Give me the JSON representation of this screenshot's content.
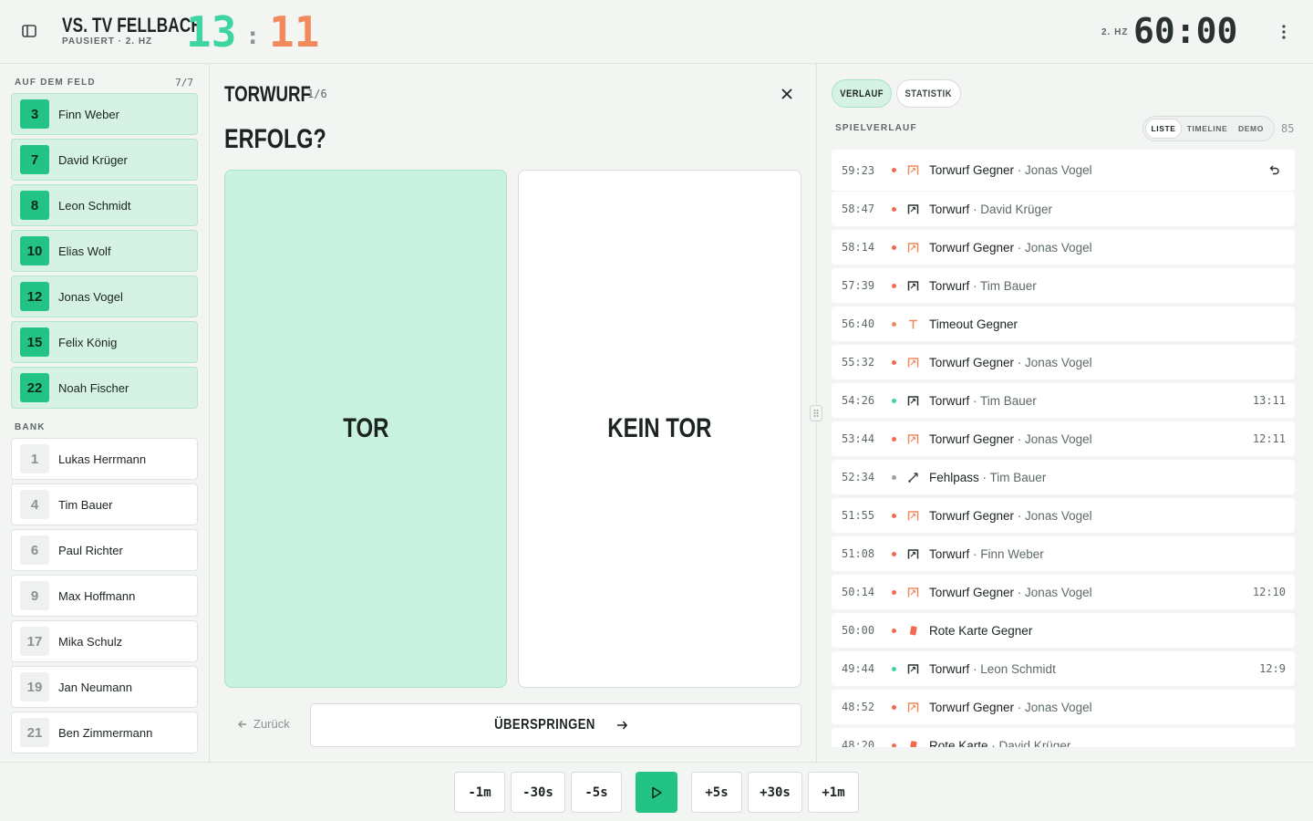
{
  "header": {
    "team_name": "VS. TV FELLBACH",
    "status": "PAUSIERT · 2. HZ",
    "score_home": "13",
    "score_sep": ":",
    "score_away": "11",
    "half_label": "2. HZ",
    "clock": "60:00"
  },
  "left_panel": {
    "field_title": "AUF DEM FELD",
    "field_count": "7/7",
    "field_players": [
      {
        "number": "3",
        "name": "Finn Weber"
      },
      {
        "number": "7",
        "name": "David Krüger"
      },
      {
        "number": "8",
        "name": "Leon Schmidt"
      },
      {
        "number": "10",
        "name": "Elias Wolf"
      },
      {
        "number": "12",
        "name": "Jonas Vogel"
      },
      {
        "number": "15",
        "name": "Felix König"
      },
      {
        "number": "22",
        "name": "Noah Fischer"
      }
    ],
    "bench_title": "BANK",
    "bench_players": [
      {
        "number": "1",
        "name": "Lukas Herrmann"
      },
      {
        "number": "4",
        "name": "Tim Bauer"
      },
      {
        "number": "6",
        "name": "Paul Richter"
      },
      {
        "number": "9",
        "name": "Max Hoffmann"
      },
      {
        "number": "17",
        "name": "Mika Schulz"
      },
      {
        "number": "19",
        "name": "Jan Neumann"
      },
      {
        "number": "21",
        "name": "Ben Zimmermann"
      }
    ]
  },
  "action": {
    "title": "TORWURF",
    "step": "1/6",
    "question": "ERFOLG?",
    "option_yes": "TOR",
    "option_no": "KEIN TOR",
    "back_label": "Zurück",
    "skip_label": "ÜBERSPRINGEN"
  },
  "right_panel": {
    "tabs": [
      "VERLAUF",
      "STATISTIK"
    ],
    "log_title": "SPIELVERLAUF",
    "view_modes": [
      "LISTE",
      "TIMELINE",
      "DEMO"
    ],
    "event_count": "85",
    "events": [
      {
        "time": "59:23",
        "type": "Torwurf Gegner",
        "sep": " · ",
        "player": "Jonas Vogel",
        "score": "",
        "dot": "#f26b4f",
        "icon": "goal-opponent-icon"
      },
      {
        "time": "58:47",
        "type": "Torwurf",
        "sep": " · ",
        "player": "David Krüger",
        "score": "",
        "dot": "#f26b4f",
        "icon": "goal-icon"
      },
      {
        "time": "58:14",
        "type": "Torwurf Gegner",
        "sep": " · ",
        "player": "Jonas Vogel",
        "score": "",
        "dot": "#f26b4f",
        "icon": "goal-opponent-icon"
      },
      {
        "time": "57:39",
        "type": "Torwurf",
        "sep": " · ",
        "player": "Tim Bauer",
        "score": "",
        "dot": "#f26b4f",
        "icon": "goal-icon"
      },
      {
        "time": "56:40",
        "type": "Timeout Gegner",
        "sep": "",
        "player": "",
        "score": "",
        "dot": "#f08a5d",
        "icon": "timeout-icon"
      },
      {
        "time": "55:32",
        "type": "Torwurf Gegner",
        "sep": " · ",
        "player": "Jonas Vogel",
        "score": "",
        "dot": "#f26b4f",
        "icon": "goal-opponent-icon"
      },
      {
        "time": "54:26",
        "type": "Torwurf",
        "sep": " · ",
        "player": "Tim Bauer",
        "score": "13:11",
        "dot": "#3fd5a0",
        "icon": "goal-icon"
      },
      {
        "time": "53:44",
        "type": "Torwurf Gegner",
        "sep": " · ",
        "player": "Jonas Vogel",
        "score": "12:11",
        "dot": "#f26b4f",
        "icon": "goal-opponent-icon"
      },
      {
        "time": "52:34",
        "type": "Fehlpass",
        "sep": " · ",
        "player": "Tim Bauer",
        "score": "",
        "dot": "#9aa39f",
        "icon": "pass-icon"
      },
      {
        "time": "51:55",
        "type": "Torwurf Gegner",
        "sep": " · ",
        "player": "Jonas Vogel",
        "score": "",
        "dot": "#f26b4f",
        "icon": "goal-opponent-icon"
      },
      {
        "time": "51:08",
        "type": "Torwurf",
        "sep": " · ",
        "player": "Finn Weber",
        "score": "",
        "dot": "#f26b4f",
        "icon": "goal-icon"
      },
      {
        "time": "50:14",
        "type": "Torwurf Gegner",
        "sep": " · ",
        "player": "Jonas Vogel",
        "score": "12:10",
        "dot": "#f26b4f",
        "icon": "goal-opponent-icon"
      },
      {
        "time": "50:00",
        "type": "Rote Karte Gegner",
        "sep": "",
        "player": "",
        "score": "",
        "dot": "#f26b4f",
        "icon": "red-card-icon"
      },
      {
        "time": "49:44",
        "type": "Torwurf",
        "sep": " · ",
        "player": "Leon Schmidt",
        "score": "12:9",
        "dot": "#3fd5a0",
        "icon": "goal-icon"
      },
      {
        "time": "48:52",
        "type": "Torwurf Gegner",
        "sep": " · ",
        "player": "Jonas Vogel",
        "score": "",
        "dot": "#f26b4f",
        "icon": "goal-opponent-icon"
      },
      {
        "time": "48:20",
        "type": "Rote Karte",
        "sep": " · ",
        "player": "David Krüger",
        "score": "",
        "dot": "#f26b4f",
        "icon": "red-card-icon"
      }
    ]
  },
  "footer": {
    "buttons": [
      "-1m",
      "-30s",
      "-5s",
      "+5s",
      "+30s",
      "+1m"
    ]
  },
  "colors": {
    "home": "#3fd5a0",
    "away": "#f08a5d",
    "accent": "#22c384"
  }
}
